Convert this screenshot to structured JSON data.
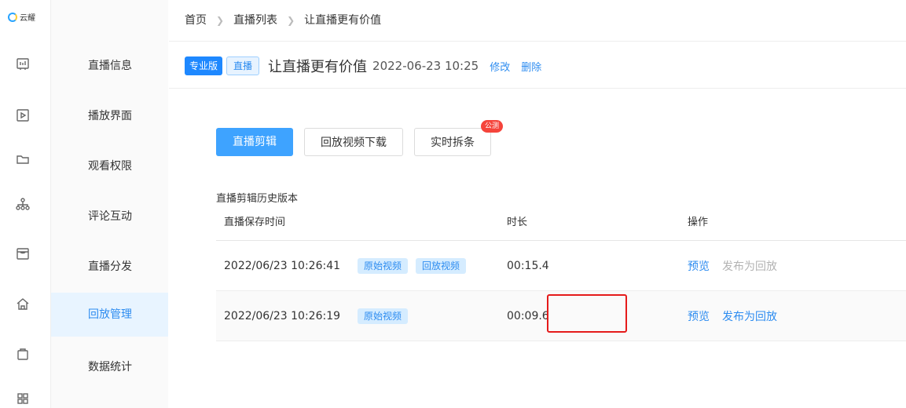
{
  "logo": {
    "text": "云耀"
  },
  "rail_icons": [
    "chart-board-icon",
    "play-video-icon",
    "folder-icon",
    "org-tree-icon",
    "storefront-icon",
    "home-icon",
    "shopping-bag-icon",
    "grid-apps-icon"
  ],
  "menu": {
    "items": [
      "直播信息",
      "播放界面",
      "观看权限",
      "评论互动",
      "直播分发",
      "回放管理",
      "数据统计"
    ],
    "active": "回放管理"
  },
  "breadcrumb": [
    "首页",
    "直播列表",
    "让直播更有价值"
  ],
  "header": {
    "edition_tag": "专业版",
    "type_tag": "直播",
    "title": "让直播更有价值",
    "datetime": "2022-06-23 10:25",
    "edit_label": "修改",
    "delete_label": "删除"
  },
  "actions": {
    "clip_label": "直播剪辑",
    "download_label": "回放视频下载",
    "split_label": "实时拆条",
    "split_badge": "公测"
  },
  "history": {
    "title": "直播剪辑历史版本",
    "columns": [
      "直播保存时间",
      "时长",
      "操作"
    ],
    "rows": [
      {
        "time": "2022/06/23 10:26:41",
        "badges": [
          "原始视频",
          "回放视频"
        ],
        "duration": "00:15.4",
        "preview": "预览",
        "publish": "发布为回放",
        "publish_enabled": false
      },
      {
        "time": "2022/06/23 10:26:19",
        "badges": [
          "原始视频"
        ],
        "duration": "00:09.6",
        "preview": "预览",
        "publish": "发布为回放",
        "publish_enabled": true
      }
    ]
  },
  "colors": {
    "accent": "#2d8cf0",
    "primary_button": "#3ea3ff",
    "highlight": "#e51b1b",
    "badge_red": "#f5443b"
  }
}
